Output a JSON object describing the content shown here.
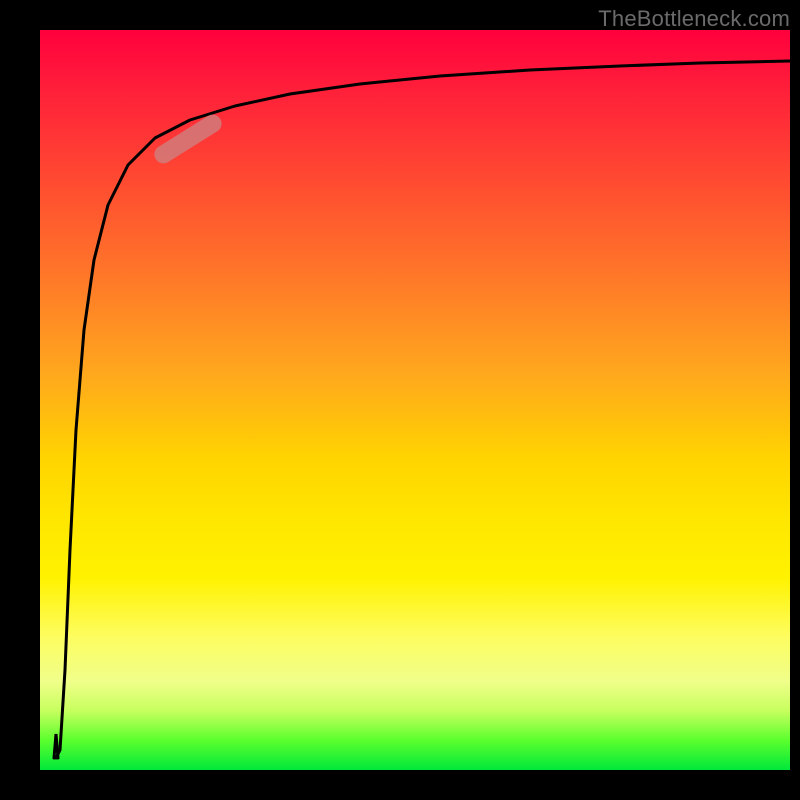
{
  "attribution": "TheBottleneck.com",
  "colors": {
    "top": "#ff003d",
    "mid_top": "#ff7a28",
    "mid": "#ffd400",
    "mid_bottom": "#fff200",
    "bottom": "#00e83a",
    "curve": "#000000",
    "highlight": "rgba(205,130,130,0.78)"
  },
  "chart_data": {
    "type": "line",
    "title": "",
    "xlabel": "",
    "ylabel": "",
    "xlim": [
      0,
      100
    ],
    "ylim": [
      0,
      100
    ],
    "series": [
      {
        "name": "bottleneck-curve",
        "x": [
          2,
          3,
          4,
          5,
          6,
          8,
          10,
          12,
          15,
          20,
          25,
          30,
          40,
          50,
          60,
          70,
          80,
          90,
          100
        ],
        "values": [
          2,
          20,
          45,
          60,
          70,
          78,
          82,
          84,
          86,
          88,
          89.5,
          90.5,
          92,
          93,
          93.8,
          94.4,
          94.8,
          95.1,
          95.4
        ]
      }
    ],
    "highlight_range_x": [
      15,
      23
    ],
    "notes": "Background is a vertical gradient from red (top, high bottleneck) through orange/yellow to green (bottom, low/no bottleneck). The black curve starts near the bottom-left, shoots up steeply, then asymptotically flattens near the top. A small rosy pill marks a segment on the rising part of the curve."
  }
}
